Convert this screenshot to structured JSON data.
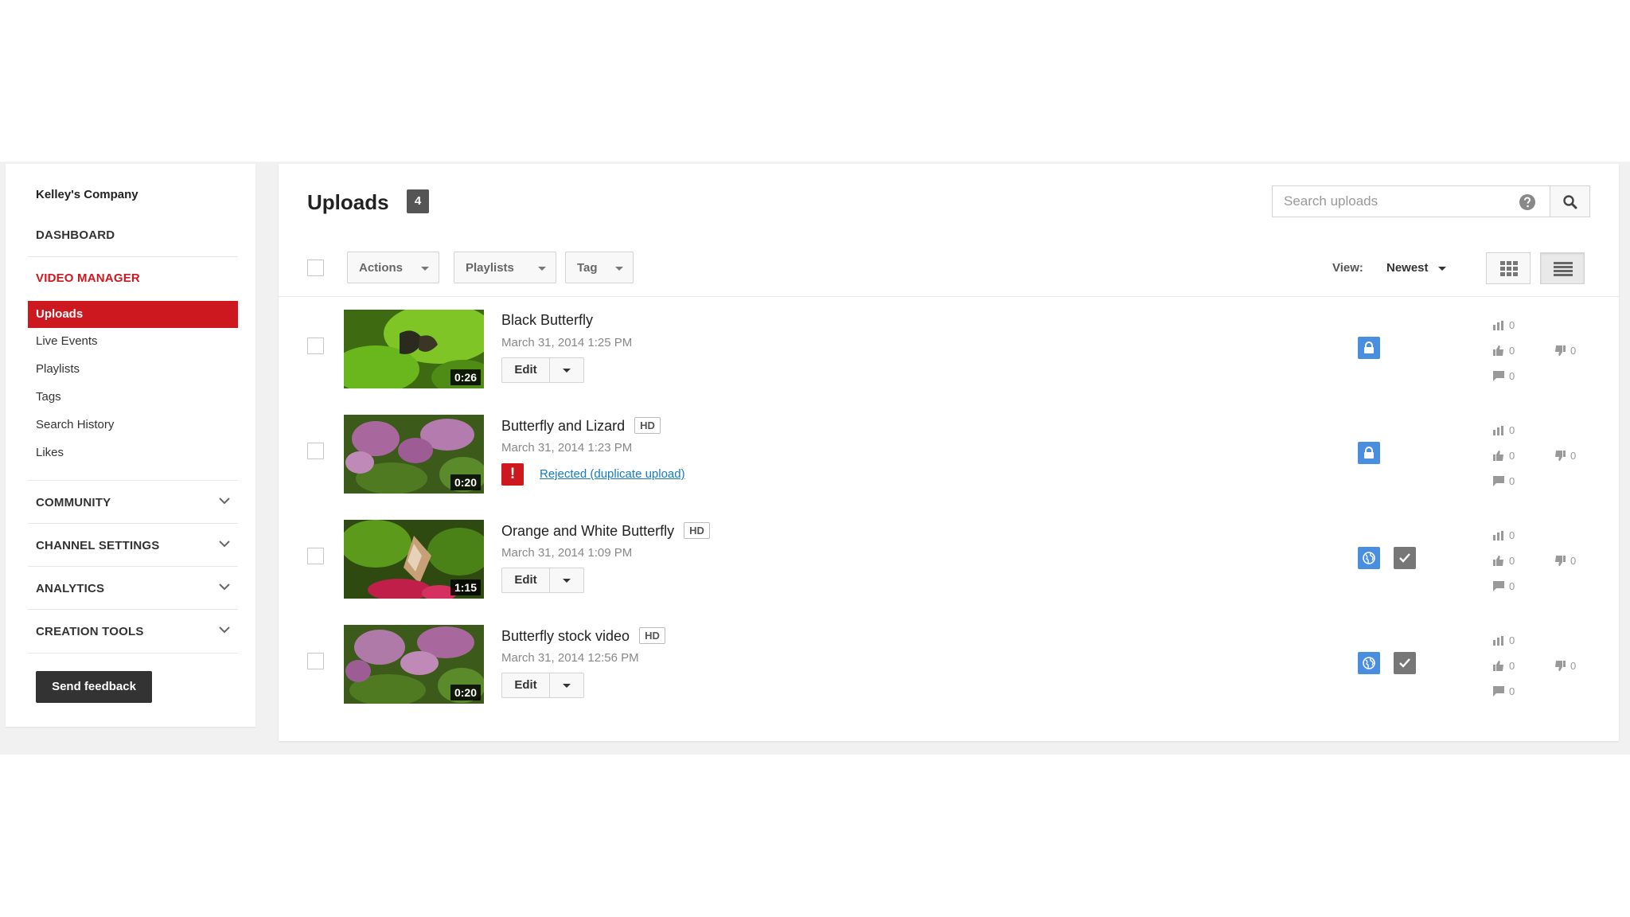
{
  "sidebar": {
    "company": "Kelley's Company",
    "dashboard": "DASHBOARD",
    "video_manager": "VIDEO MANAGER",
    "items": [
      "Uploads",
      "Live Events",
      "Playlists",
      "Tags",
      "Search History",
      "Likes"
    ],
    "sections": [
      "COMMUNITY",
      "CHANNEL SETTINGS",
      "ANALYTICS",
      "CREATION TOOLS"
    ],
    "feedback_label": "Send feedback"
  },
  "main": {
    "title": "Uploads",
    "count": "4",
    "search": {
      "placeholder": "Search uploads"
    },
    "toolbar": {
      "actions_label": "Actions",
      "playlists_label": "Playlists",
      "tag_label": "Tag",
      "view_label": "View:",
      "sort_value": "Newest"
    },
    "videos": [
      {
        "title": "Black Butterfly",
        "hd": "",
        "date": "March 31, 2014 1:25 PM",
        "duration": "0:26",
        "edit_label": "Edit",
        "privacy_icon": "lock-icon",
        "views": "0",
        "likes": "0",
        "dislikes": "0",
        "comments": "0"
      },
      {
        "title": "Butterfly and Lizard",
        "hd": "HD",
        "date": "March 31, 2014 1:23 PM",
        "duration": "0:20",
        "status_text": "Rejected (duplicate upload)",
        "alert_symbol": "!",
        "privacy_icon": "lock-icon",
        "views": "0",
        "likes": "0",
        "dislikes": "0",
        "comments": "0"
      },
      {
        "title": "Orange and White Butterfly",
        "hd": "HD",
        "date": "March 31, 2014 1:09 PM",
        "duration": "1:15",
        "edit_label": "Edit",
        "privacy_icon": "globe-icon",
        "views": "0",
        "likes": "0",
        "dislikes": "0",
        "comments": "0"
      },
      {
        "title": "Butterfly stock video",
        "hd": "HD",
        "date": "March 31, 2014 12:56 PM",
        "duration": "0:20",
        "edit_label": "Edit",
        "privacy_icon": "globe-icon",
        "views": "0",
        "likes": "0",
        "dislikes": "0",
        "comments": "0"
      }
    ]
  },
  "colors": {
    "brand_red": "#cc181e",
    "link_blue": "#167ac6",
    "privacy_blue": "#4a8ee0"
  }
}
